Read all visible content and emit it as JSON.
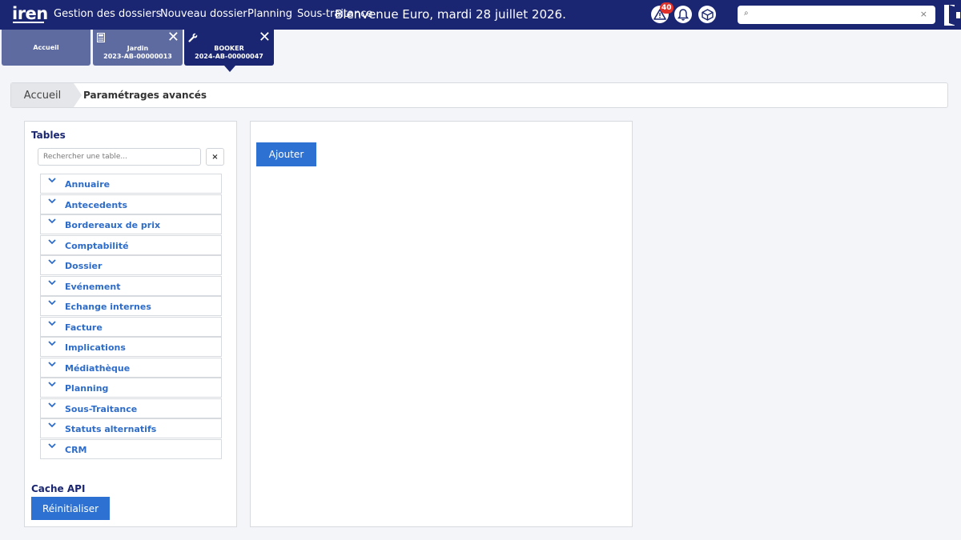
{
  "header": {
    "logo_text": "iren",
    "nav": [
      "Gestion des dossiers",
      "Nouveau dossier",
      "Planning",
      "Sous-traitance"
    ],
    "welcome": "Bienvenue Euro, mardi 28 juillet 2026.",
    "alerts_badge": "40",
    "search": {
      "value": "",
      "placeholder": "",
      "clear": "×"
    },
    "colors": {
      "bar": "#1a2672",
      "badge": "#e0312b"
    }
  },
  "tabs": [
    {
      "title": "Accueil",
      "icon": "home"
    },
    {
      "title": "Jardin",
      "subtitle": "2023-AB-00000013",
      "icon": "calculator-icon",
      "close": "✕"
    },
    {
      "title": "BOOKER",
      "subtitle": "2024-AB-00000047",
      "icon": "wrench-icon",
      "close": "✕",
      "active": true
    }
  ],
  "breadcrumb": {
    "home": "Accueil",
    "current": "Paramétrages avancés"
  },
  "tables_panel": {
    "title": "Tables",
    "search_placeholder": "Rechercher une table...",
    "clear": "×",
    "items": [
      "Annuaire",
      "Antecedents",
      "Bordereaux de prix",
      "Comptabilité",
      "Dossier",
      "Evénement",
      "Echange internes",
      "Facture",
      "Implications",
      "Médiathèque",
      "Planning",
      "Sous-Traitance",
      "Statuts alternatifs",
      "CRM"
    ]
  },
  "cache_api": {
    "title": "Cache API",
    "reset_label": "Réinitialiser"
  },
  "main_panel": {
    "add_label": "Ajouter"
  },
  "accent_color": "#2d72d2"
}
